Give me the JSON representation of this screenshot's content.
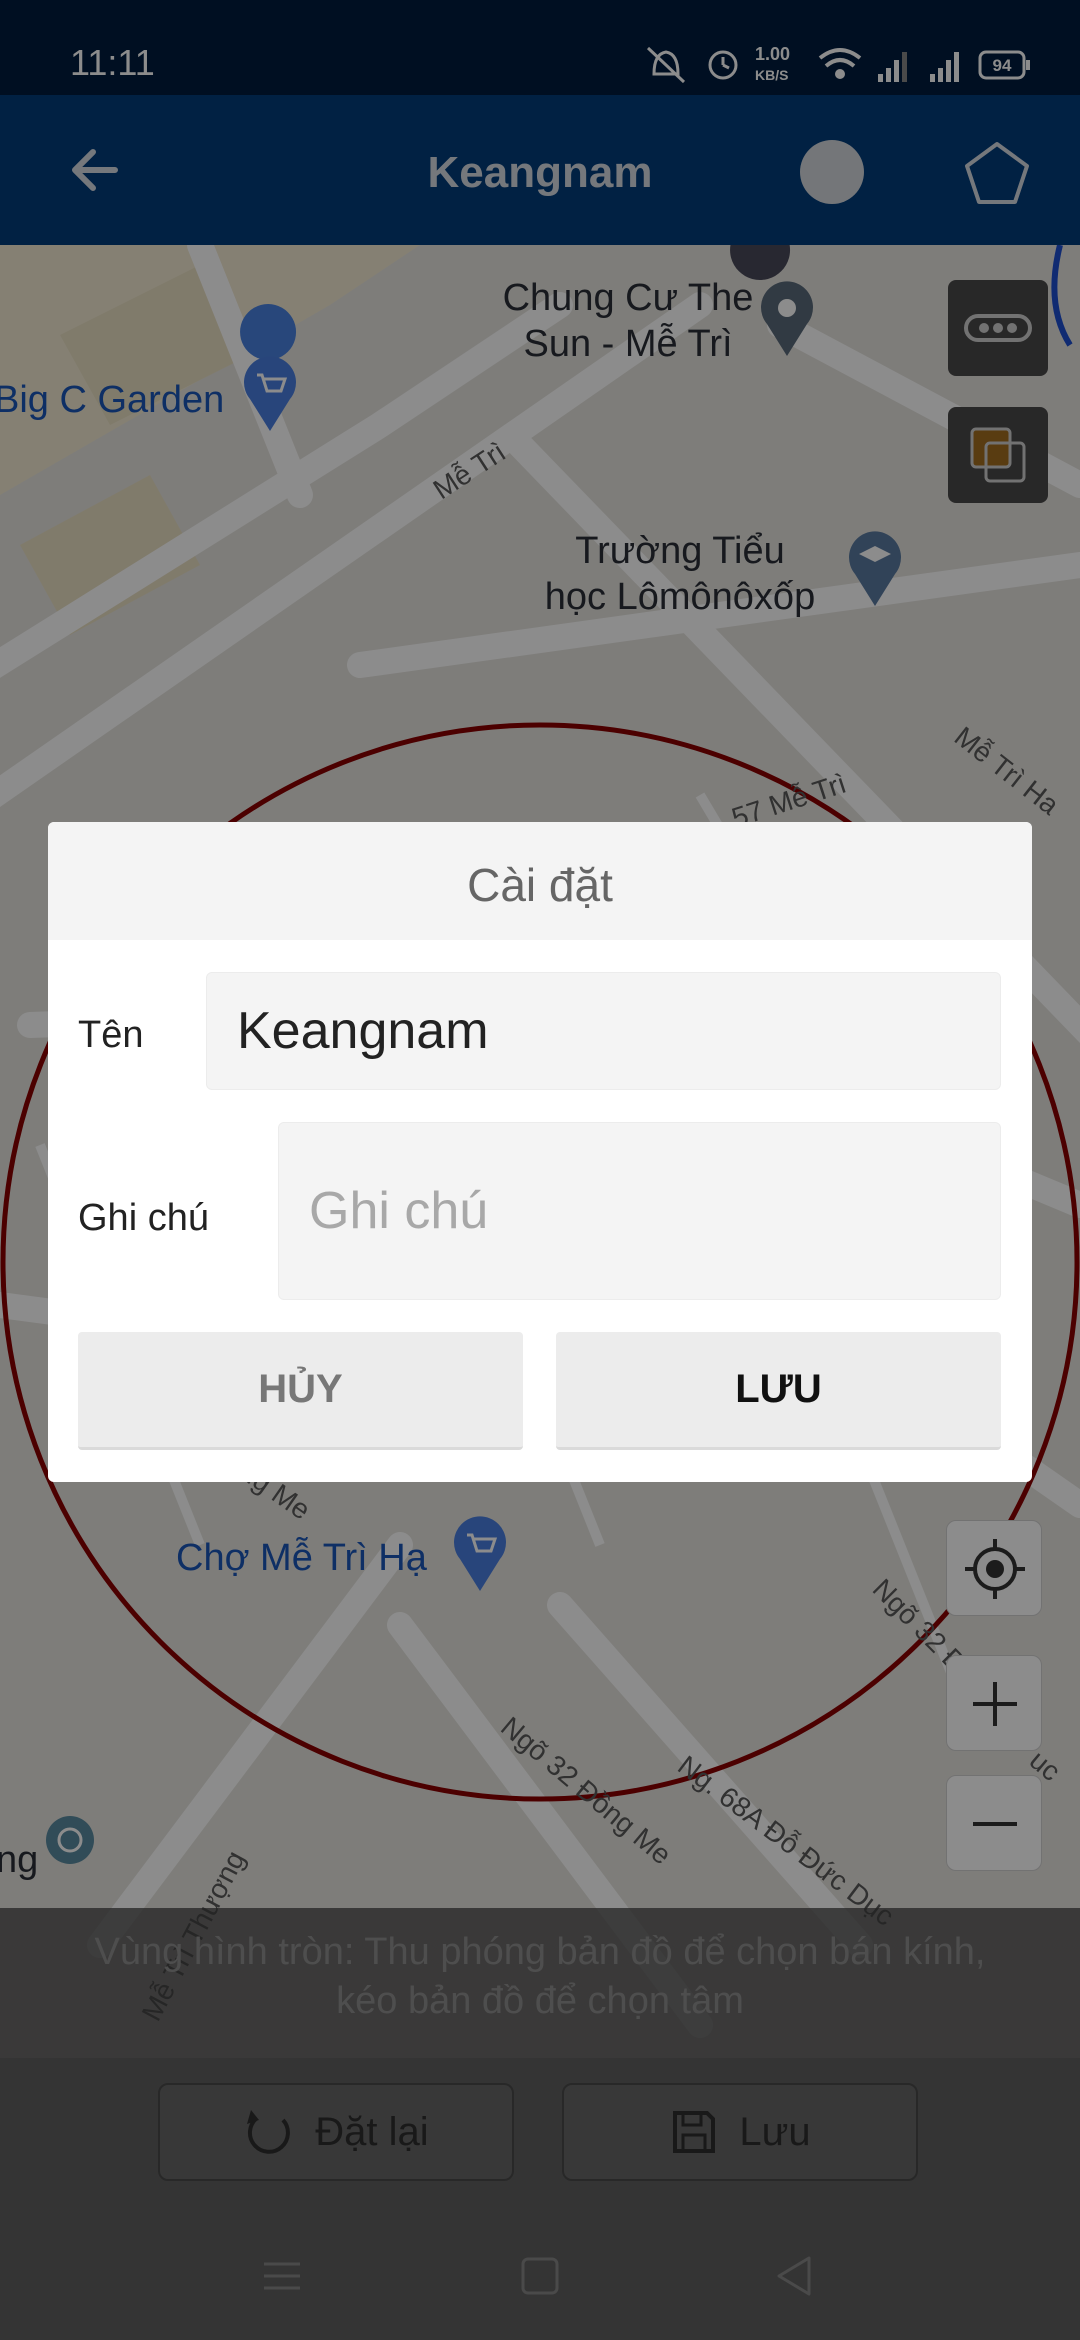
{
  "status_bar": {
    "time": "11:11",
    "network_speed_value": "1.00",
    "network_speed_unit": "KB/S",
    "battery": "94",
    "icons": [
      "mute-icon",
      "alarm-icon",
      "wifi-icon",
      "signal-icon",
      "signal-icon",
      "battery-icon"
    ]
  },
  "header": {
    "title": "Keangnam",
    "back_icon": "arrow-left-icon",
    "shape_circle_icon": "circle-icon",
    "shape_polygon_icon": "pentagon-icon"
  },
  "map": {
    "places": [
      {
        "name_line1": "Chung Cư The",
        "name_line2": "Sun - Mễ Trì"
      },
      {
        "name_line1": "Big C Garden"
      },
      {
        "name_line1": "Trường Tiểu",
        "name_line2": "học Lômônôxốp"
      },
      {
        "name_line1": "Chợ Mễ Trì Hạ"
      }
    ],
    "streets": [
      "Mễ Trì",
      "Mễ Trì Ha",
      "57 Mễ Trì",
      "Ngõ 32 Đồng Me",
      "Ng. 68A Đỗ Đức Dục",
      "Ngõ 32 Đ",
      "ng Me",
      "Mễ Trì Thượng",
      "uc",
      "ng"
    ],
    "controls": {
      "more_icon": "more-horizontal-icon",
      "layers_icon": "layers-icon",
      "locate_icon": "crosshair-icon",
      "zoom_in_icon": "plus-icon",
      "zoom_out_icon": "minus-icon"
    },
    "circle_color": "#8b0000"
  },
  "hint": {
    "line1": "Vùng hình tròn: Thu phóng bản đồ để chọn bán kính,",
    "line2": "kéo bản đồ để chọn tâm"
  },
  "bottom": {
    "reset_label": "Đặt lại",
    "reset_icon": "refresh-icon",
    "save_label": "Lưu",
    "save_icon": "floppy-icon"
  },
  "dialog": {
    "title": "Cài đặt",
    "name_label": "Tên",
    "name_value": "Keangnam",
    "note_label": "Ghi chú",
    "note_placeholder": "Ghi chú",
    "cancel_label": "HỦY",
    "save_label": "LƯU"
  },
  "system_nav": {
    "menu_icon": "menu-icon",
    "home_icon": "square-icon",
    "back_icon": "triangle-back-icon"
  },
  "colors": {
    "header_bg": "#023c7a",
    "status_bg": "#011d3f",
    "circle_stroke": "#8b0000"
  }
}
